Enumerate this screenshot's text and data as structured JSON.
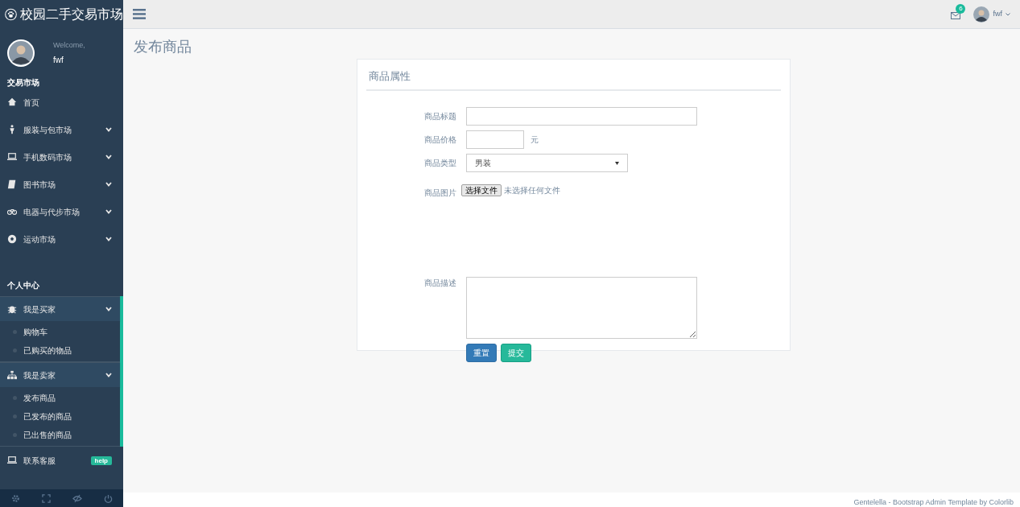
{
  "brand": {
    "title": "校园二手交易市场"
  },
  "profile": {
    "greeting": "Welcome,",
    "name": "fwf"
  },
  "sidebar": {
    "sections": [
      {
        "title": "交易市场",
        "items": [
          {
            "label": "首页",
            "chevron": false,
            "expanded": false
          },
          {
            "label": "服装与包市场",
            "chevron": true,
            "expanded": false
          },
          {
            "label": "手机数码市场",
            "chevron": true,
            "expanded": false
          },
          {
            "label": "图书市场",
            "chevron": true,
            "expanded": false
          },
          {
            "label": "电器与代步市场",
            "chevron": true,
            "expanded": false
          },
          {
            "label": "运动市场",
            "chevron": true,
            "expanded": false
          }
        ]
      },
      {
        "title": "个人中心",
        "items": [
          {
            "label": "我是买家",
            "chevron": true,
            "expanded": true,
            "children": [
              {
                "label": "购物车"
              },
              {
                "label": "已购买的物品"
              }
            ]
          },
          {
            "label": "我是卖家",
            "chevron": true,
            "expanded": true,
            "children": [
              {
                "label": "发布商品"
              },
              {
                "label": "已发布的商品"
              },
              {
                "label": "已出售的商品"
              }
            ]
          },
          {
            "label": "联系客服",
            "chevron": false,
            "expanded": false,
            "badge": "help"
          }
        ]
      }
    ]
  },
  "topbar": {
    "mail_count": "6",
    "user": "fwf"
  },
  "page_title": "发布商品",
  "form": {
    "title": "商品属性",
    "fields": [
      {
        "kind": "text",
        "label": "商品标题"
      },
      {
        "kind": "price",
        "label": "商品价格",
        "unit": "元"
      },
      {
        "kind": "select",
        "label": "商品类型",
        "value": "男装"
      },
      {
        "kind": "file",
        "label": "商品图片",
        "button": "选择文件",
        "status": "未选择任何文件"
      },
      {
        "kind": "textarea",
        "label": "商品描述"
      }
    ],
    "buttons": [
      {
        "label": "重置",
        "kind": "reset"
      },
      {
        "label": "提交",
        "kind": "submit"
      }
    ]
  },
  "footer": {
    "credit": "Gentelella - Bootstrap Admin Template by Colorlib"
  }
}
